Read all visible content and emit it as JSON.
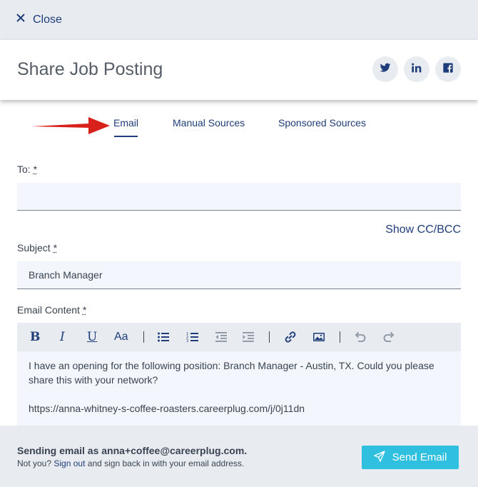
{
  "topbar": {
    "close_label": "Close"
  },
  "header": {
    "title": "Share Job Posting",
    "social": [
      "twitter-icon",
      "linkedin-icon",
      "facebook-icon"
    ]
  },
  "tabs": [
    {
      "label": "Email",
      "active": true
    },
    {
      "label": "Manual Sources",
      "active": false
    },
    {
      "label": "Sponsored Sources",
      "active": false
    }
  ],
  "form": {
    "to": {
      "label": "To:",
      "required_mark": "*",
      "value": ""
    },
    "show_cc_bcc": "Show CC/BCC",
    "subject": {
      "label": "Subject",
      "required_mark": "*",
      "value": "Branch Manager"
    },
    "content": {
      "label": "Email Content",
      "required_mark": "*",
      "toolbar": {
        "bold": "B",
        "italic": "I",
        "underline": "U",
        "font_size": "Aa",
        "icons": [
          "bulleted-list-icon",
          "numbered-list-icon",
          "outdent-icon",
          "indent-icon",
          "link-icon",
          "image-icon",
          "undo-icon",
          "redo-icon"
        ]
      },
      "line1": "I have an opening for the following position: Branch Manager - Austin, TX. Could you please share this with your network?",
      "line2": "https://anna-whitney-s-coffee-roasters.careerplug.com/j/0j11dn"
    }
  },
  "footer": {
    "sending_as": "Sending email as anna+coffee@careerplug.com.",
    "not_you_prefix": "Not you?",
    "sign_out": "Sign out",
    "not_you_suffix": "and sign back in with your email address.",
    "send_label": "Send Email"
  },
  "colors": {
    "brand_navy": "#1f3d7a",
    "send_button": "#2fc0e0",
    "arrow_red": "#d9211c",
    "panel_gray": "#e8ecf1",
    "field_bg": "#f3f6fc"
  }
}
